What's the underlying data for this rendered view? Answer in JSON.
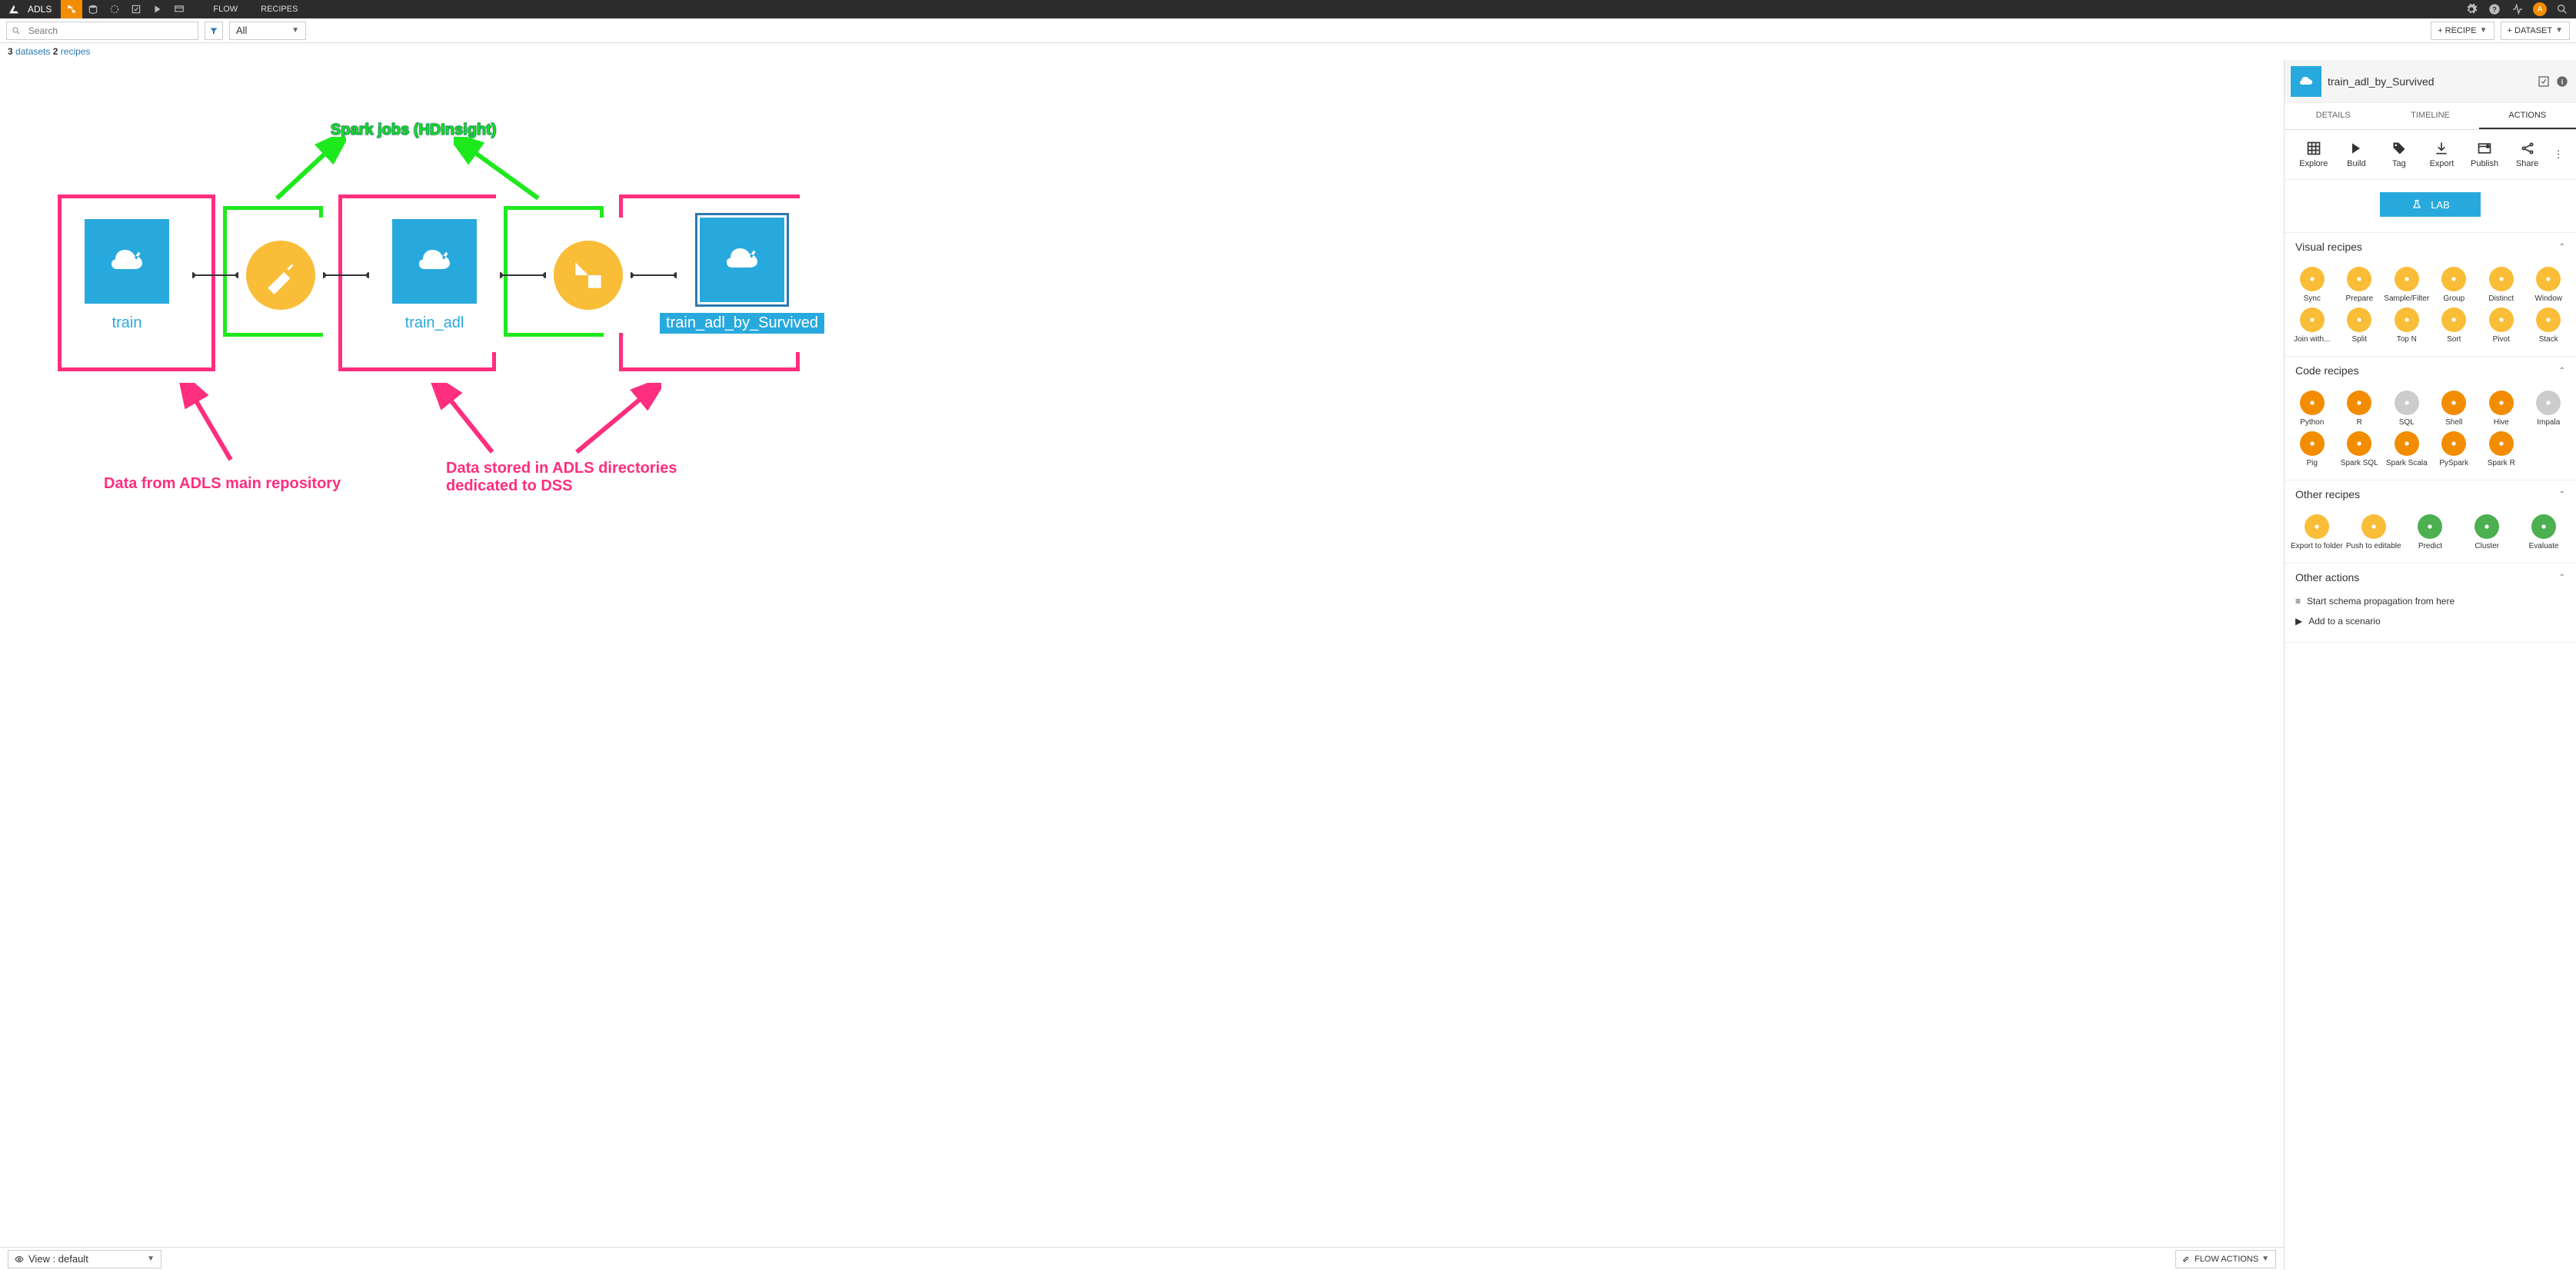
{
  "topbar": {
    "project_title": "ADLS",
    "tabs": {
      "flow": "FLOW",
      "recipes": "RECIPES"
    },
    "avatar_letter": "A"
  },
  "subbar": {
    "search_placeholder": "Search",
    "filter_all": "All",
    "add_recipe": "+ RECIPE",
    "add_dataset": "+ DATASET"
  },
  "counts": {
    "datasets_n": "3",
    "datasets_label": "datasets",
    "recipes_n": "2",
    "recipes_label": "recipes"
  },
  "flow": {
    "nodes": [
      {
        "id": "train",
        "label": "train"
      },
      {
        "id": "train_adl",
        "label": "train_adl"
      },
      {
        "id": "train_adl_by_Survived",
        "label": "train_adl_by_Survived"
      }
    ]
  },
  "annotations": {
    "spark": "Spark jobs (HDInsight)",
    "main_repo": "Data from ADLS main repository",
    "dss_dirs": "Data stored in ADLS directories dedicated to DSS"
  },
  "bottombar": {
    "view_label": "View : default",
    "flow_actions": "FLOW ACTIONS"
  },
  "sidepanel": {
    "title": "train_adl_by_Survived",
    "tabs": {
      "details": "DETAILS",
      "timeline": "TIMELINE",
      "actions": "ACTIONS"
    },
    "actions": {
      "explore": "Explore",
      "build": "Build",
      "tag": "Tag",
      "export": "Export",
      "publish": "Publish",
      "share": "Share"
    },
    "lab": "LAB",
    "sections": {
      "visual": {
        "title": "Visual recipes",
        "items": [
          "Sync",
          "Prepare",
          "Sample/Filter",
          "Group",
          "Distinct",
          "Window",
          "Join with...",
          "Split",
          "Top N",
          "Sort",
          "Pivot",
          "Stack"
        ]
      },
      "code": {
        "title": "Code recipes",
        "items": [
          "Python",
          "R",
          "SQL",
          "Shell",
          "Hive",
          "Impala",
          "Pig",
          "Spark SQL",
          "Spark Scala",
          "PySpark",
          "Spark R"
        ]
      },
      "other": {
        "title": "Other recipes",
        "items": [
          "Export to folder",
          "Push to editable",
          "Predict",
          "Cluster",
          "Evaluate"
        ]
      },
      "other_actions": {
        "title": "Other actions",
        "items": [
          "Start schema propagation from here",
          "Add to a scenario"
        ]
      }
    }
  }
}
